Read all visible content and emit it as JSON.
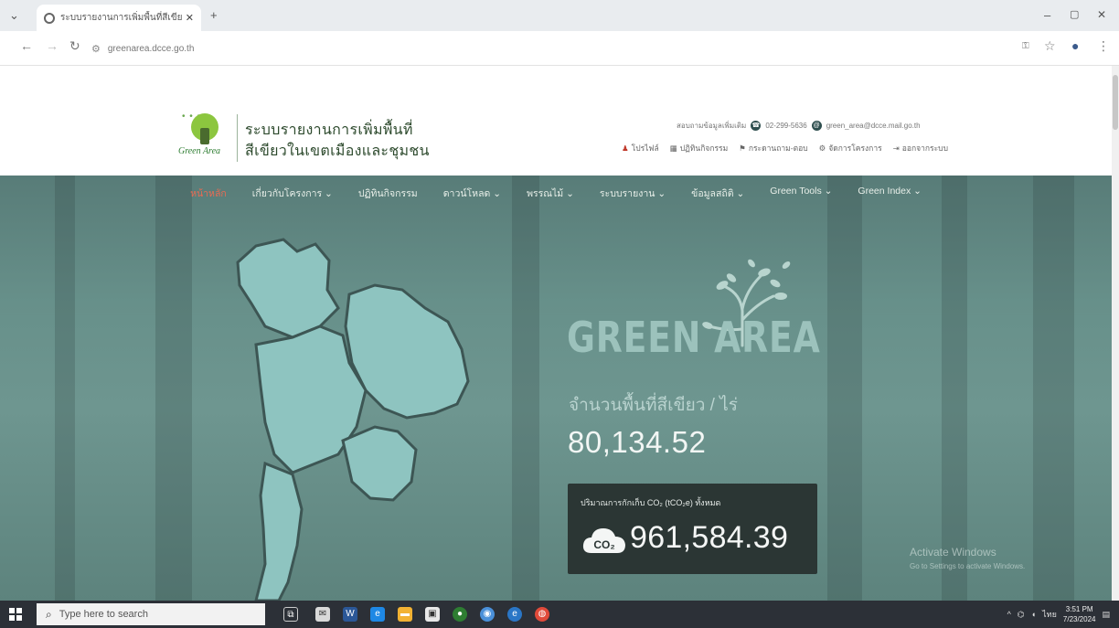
{
  "browser": {
    "tab_title": "ระบบรายงานการเพิ่มพื้นที่สีเขียว",
    "new_tab": "+",
    "url": "greenarea.dcce.go.th",
    "window_buttons": {
      "min": "–",
      "max": "▢",
      "close": "✕"
    }
  },
  "header": {
    "logo_text": "Green Area",
    "title_line1": "ระบบรายงานการเพิ่มพื้นที่",
    "title_line2": "สีเขียวในเขตเมืองและชุมชน",
    "contact_label": "สอบถามข้อมูลเพิ่มเติม",
    "phone": "02-299-5636",
    "email": "green_area@dcce.mail.go.th",
    "links": [
      {
        "icon": "person-icon",
        "label": "โปรไฟล์"
      },
      {
        "icon": "calendar-icon",
        "label": "ปฏิทินกิจกรรม"
      },
      {
        "icon": "flag-icon",
        "label": "กระดานถาม-ตอบ"
      },
      {
        "icon": "gear-icon",
        "label": "จัดการโครงการ"
      },
      {
        "icon": "logout-icon",
        "label": "ออกจากระบบ"
      }
    ]
  },
  "menu": [
    {
      "label": "หน้าหลัก",
      "active": true
    },
    {
      "label": "เกี่ยวกับโครงการ ⌄",
      "active": false
    },
    {
      "label": "ปฏิทินกิจกรรม",
      "active": false
    },
    {
      "label": "ดาวน์โหลด ⌄",
      "active": false
    },
    {
      "label": "พรรณไม้ ⌄",
      "active": false
    },
    {
      "label": "ระบบรายงาน ⌄",
      "active": false
    },
    {
      "label": "ข้อมูลสถิติ ⌄",
      "active": false
    },
    {
      "label": "Green Tools ⌄",
      "active": false
    },
    {
      "label": "Green Index ⌄",
      "active": false
    }
  ],
  "hero": {
    "title": "GREEN AREA",
    "subtitle": "จำนวนพื้นที่สีเขียว / ไร่",
    "area_value": "80,134.52",
    "co2_label": "ปริมาณการกักเก็บ CO₂ (tCO₂e) ทั้งหมด",
    "co2_badge": "CO₂",
    "co2_value": "961,584.39"
  },
  "watermark": {
    "line1": "Activate Windows",
    "line2": "Go to Settings to activate Windows."
  },
  "taskbar": {
    "search_placeholder": "Type here to search",
    "time": "3:51 PM",
    "date": "7/23/2024"
  },
  "colors": {
    "hero_bg": "#67908a",
    "menu_active": "#e96b53",
    "co2_box": "#2b3634",
    "title_green": "#9cc2bc"
  }
}
